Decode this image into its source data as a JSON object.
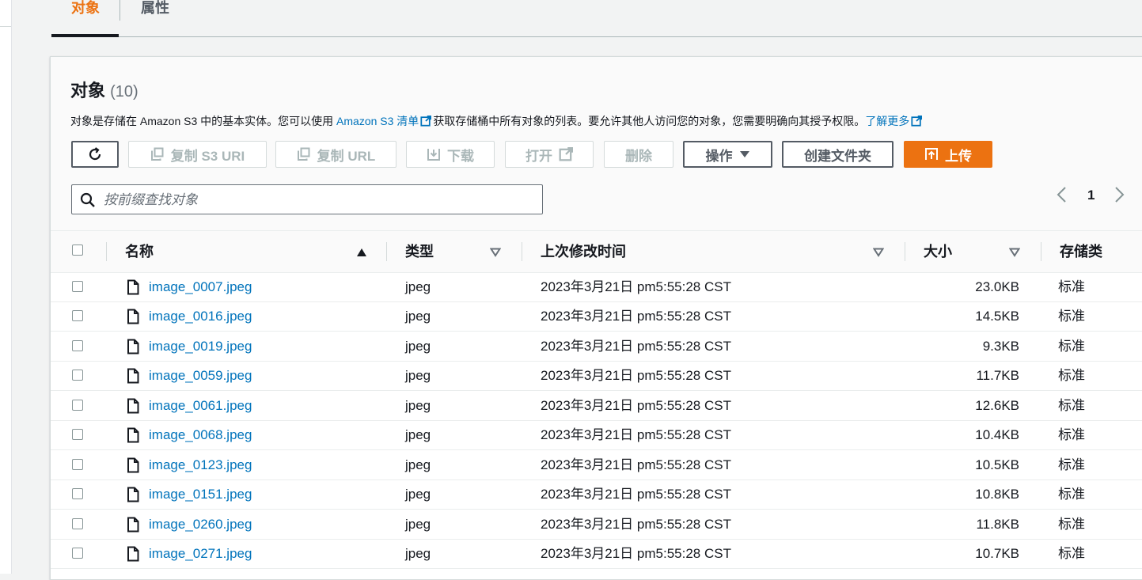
{
  "tabs": [
    {
      "label": "对象",
      "active": true
    },
    {
      "label": "属性",
      "active": false
    }
  ],
  "panel": {
    "title": "对象",
    "count": "(10)",
    "description": {
      "part1": "对象是存储在 Amazon S3 中的基本实体。您可以使用 ",
      "link1": "Amazon S3 清单",
      "part2": "获取存储桶中所有对象的列表。要允许其他人访问您的对象，您需要明确向其授予权限。",
      "link2": "了解更多"
    }
  },
  "toolbar": {
    "copy_s3_uri": "复制 S3 URI",
    "copy_url": "复制 URL",
    "download": "下载",
    "open": "打开",
    "delete": "删除",
    "actions": "操作",
    "create_folder": "创建文件夹",
    "upload": "上传"
  },
  "search": {
    "placeholder": "按前缀查找对象",
    "value": ""
  },
  "pagination": {
    "current": "1"
  },
  "table": {
    "headers": {
      "name": "名称",
      "type": "类型",
      "last_modified": "上次修改时间",
      "size": "大小",
      "storage_class": "存储类"
    },
    "rows": [
      {
        "name": "image_0007.jpeg",
        "type": "jpeg",
        "modified": "2023年3月21日 pm5:55:28 CST",
        "size": "23.0KB",
        "class": "标准"
      },
      {
        "name": "image_0016.jpeg",
        "type": "jpeg",
        "modified": "2023年3月21日 pm5:55:28 CST",
        "size": "14.5KB",
        "class": "标准"
      },
      {
        "name": "image_0019.jpeg",
        "type": "jpeg",
        "modified": "2023年3月21日 pm5:55:28 CST",
        "size": "9.3KB",
        "class": "标准"
      },
      {
        "name": "image_0059.jpeg",
        "type": "jpeg",
        "modified": "2023年3月21日 pm5:55:28 CST",
        "size": "11.7KB",
        "class": "标准"
      },
      {
        "name": "image_0061.jpeg",
        "type": "jpeg",
        "modified": "2023年3月21日 pm5:55:28 CST",
        "size": "12.6KB",
        "class": "标准"
      },
      {
        "name": "image_0068.jpeg",
        "type": "jpeg",
        "modified": "2023年3月21日 pm5:55:28 CST",
        "size": "10.4KB",
        "class": "标准"
      },
      {
        "name": "image_0123.jpeg",
        "type": "jpeg",
        "modified": "2023年3月21日 pm5:55:28 CST",
        "size": "10.5KB",
        "class": "标准"
      },
      {
        "name": "image_0151.jpeg",
        "type": "jpeg",
        "modified": "2023年3月21日 pm5:55:28 CST",
        "size": "10.8KB",
        "class": "标准"
      },
      {
        "name": "image_0260.jpeg",
        "type": "jpeg",
        "modified": "2023年3月21日 pm5:55:28 CST",
        "size": "11.8KB",
        "class": "标准"
      },
      {
        "name": "image_0271.jpeg",
        "type": "jpeg",
        "modified": "2023年3月21日 pm5:55:28 CST",
        "size": "10.7KB",
        "class": "标准"
      }
    ]
  },
  "colors": {
    "accent": "#ec7211",
    "link": "#0073bb",
    "text": "#16191f"
  }
}
